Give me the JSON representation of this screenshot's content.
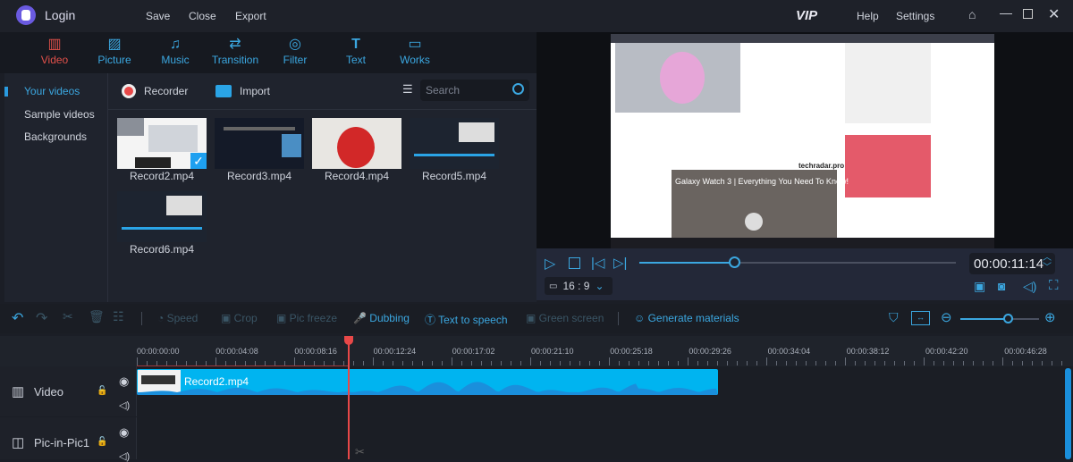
{
  "titlebar": {
    "login": "Login",
    "menu": [
      "Save",
      "Close",
      "Export"
    ],
    "vip": "VIP",
    "help": "Help",
    "settings": "Settings"
  },
  "tabs": [
    {
      "label": "Video",
      "icon": "film-icon",
      "active": true
    },
    {
      "label": "Picture",
      "icon": "picture-icon"
    },
    {
      "label": "Music",
      "icon": "music-icon"
    },
    {
      "label": "Transition",
      "icon": "transition-icon"
    },
    {
      "label": "Filter",
      "icon": "filter-icon"
    },
    {
      "label": "Text",
      "icon": "text-icon"
    },
    {
      "label": "Works",
      "icon": "folder-icon"
    }
  ],
  "library": {
    "sidebar": [
      "Your videos",
      "Sample videos",
      "Backgrounds"
    ],
    "recorder": "Recorder",
    "import": "Import",
    "search_placeholder": "Search",
    "items": [
      "Record2.mp4",
      "Record3.mp4",
      "Record4.mp4",
      "Record5.mp4",
      "Record6.mp4"
    ],
    "selected": "Record2.mp4"
  },
  "preview": {
    "video_title": "Galaxy Watch 3 | Everything You Need To Know!",
    "brand": "techradar.pro",
    "timecode": "00:00:11:14",
    "aspect": "16 : 9",
    "progress_percent": 30
  },
  "toolbar": {
    "speed": "Speed",
    "crop": "Crop",
    "pic_freeze": "Pic freeze",
    "dubbing": "Dubbing",
    "tts": "Text to speech",
    "green_screen": "Green screen",
    "generate": "Generate materials",
    "zoom_percent": 60
  },
  "timeline": {
    "ruler": [
      "00:00:00:00",
      "00:00:04:08",
      "00:00:08:16",
      "00:00:12:24",
      "00:00:17:02",
      "00:00:21:10",
      "00:00:25:18",
      "00:00:29:26",
      "00:00:34:04",
      "00:00:38:12",
      "00:00:42:20",
      "00:00:46:28"
    ],
    "tracks": [
      {
        "label": "Video"
      },
      {
        "label": "Pic-in-Pic1"
      }
    ],
    "clip": "Record2.mp4",
    "accent": "#00b4f0",
    "playhead": "#e84848"
  }
}
